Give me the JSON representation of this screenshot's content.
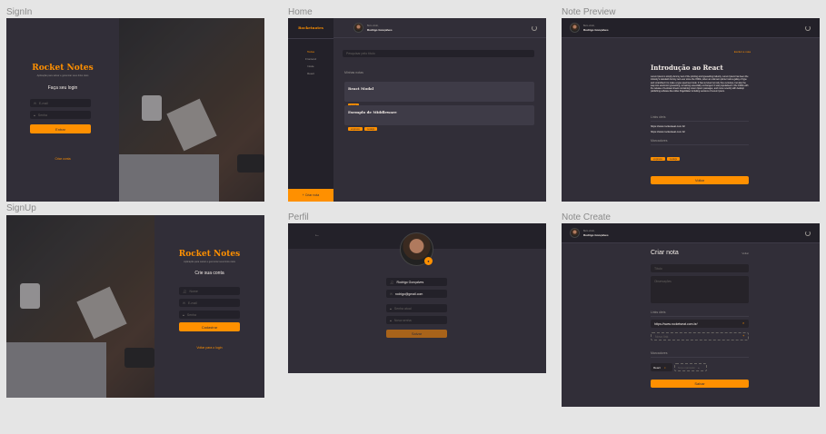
{
  "frames": {
    "signin": "SignIn",
    "home": "Home",
    "note_preview": "Note Preview",
    "signup": "SignUp",
    "perfil": "Perfil",
    "note_create": "Note Create"
  },
  "brand": {
    "name": "Rocket Notes",
    "tagline": "Aplicação para salvar e gerenciar seus links úteis",
    "sidebar_name": "Rocketnotes"
  },
  "signin": {
    "title": "Faça seu login",
    "email_placeholder": "E-mail",
    "password_placeholder": "Senha",
    "submit": "Entrar",
    "create_account": "Criar conta"
  },
  "signup": {
    "title": "Crie sua conta",
    "name_placeholder": "Nome",
    "email_placeholder": "E-mail",
    "password_placeholder": "Senha",
    "submit": "Cadastrar",
    "back_login": "Voltar para o login"
  },
  "user": {
    "greeting": "Bem-vindo,",
    "name": "Rodrigo Gonçalves",
    "email": "rodrigo@gmail.com"
  },
  "home": {
    "sidebar_items": [
      "Todos",
      "Frontend",
      "Node",
      "React"
    ],
    "search_placeholder": "Pesquisar pelo título",
    "section_title": "Minhas notas",
    "notes": [
      {
        "title": "React Modal",
        "tags": [
          "react"
        ]
      },
      {
        "title": "Exemplo de Middleware",
        "tags": [
          "express",
          "nodejs"
        ]
      }
    ],
    "new_note": "+ Criar nota"
  },
  "preview": {
    "delete": "Excluir a nota",
    "title": "Introdução ao React",
    "body": "Lorem Ipsum is simply dummy text of the printing and typesetting industry. Lorem Ipsum has been the industry's standard dummy text ever since the 1500s, when an unknown printer took a galley of type and scrambled it to make a type specimen book. It has survived not only five centuries, but also the leap into electronic typesetting, remaining essentially unchanged. It was popularised in the 1960s with the release of Letraset sheets containing Lorem Ipsum passages, and more recently with desktop publishing software like Aldus PageMaker including versions of Lorem Ipsum.",
    "links_title": "Links úteis",
    "links": [
      "https://www.rocketseat.com.br/",
      "https://www.rocketseat.com.br/"
    ],
    "markers_title": "Marcadores",
    "tags": [
      "express",
      "nodejs"
    ],
    "back": "Voltar"
  },
  "perfil": {
    "name_value": "Rodrigo Gonçalves",
    "email_value": "rodrigo@gmail.com",
    "current_password": "Senha atual",
    "new_password": "Nova senha",
    "save": "Salvar"
  },
  "create": {
    "title": "Criar nota",
    "back": "Voltar",
    "title_placeholder": "Título",
    "notes_placeholder": "Observações",
    "links_title": "Links úteis",
    "link_value": "https://www.rocketseat.com.br/",
    "new_link_placeholder": "Novo link",
    "markers_title": "Marcadores",
    "tag_value": "React",
    "new_tag_placeholder": "Novo marcador",
    "save": "Salvar"
  },
  "colors": {
    "background": "#312e38",
    "accent": "#ff9000",
    "input": "#232129",
    "text": "#f4ede8",
    "muted": "#999591"
  }
}
